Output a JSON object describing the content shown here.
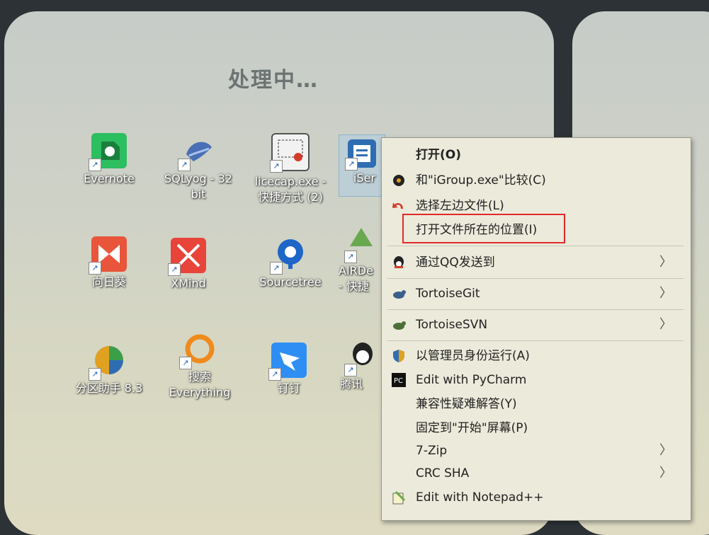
{
  "desktop": {
    "processing_text": "处理中…",
    "icons": [
      {
        "label": "Evernote",
        "icon": "evernote-icon",
        "color": "#2dbe60"
      },
      {
        "label": "SQLyog - 32\nbit",
        "icon": "sqlyog-icon",
        "color": "#4a6fb5"
      },
      {
        "label": "licecap.exe -\n快捷方式 (2)",
        "icon": "licecap-icon",
        "color": "#d23a2a"
      },
      {
        "label": "iSer",
        "icon": "iserver-icon",
        "color": "#2f6db3"
      },
      {
        "label": "向日葵",
        "icon": "sunflower-icon",
        "color": "#e8553a"
      },
      {
        "label": "XMind",
        "icon": "xmind-icon",
        "color": "#e8443a"
      },
      {
        "label": "Sourcetree",
        "icon": "sourcetree-icon",
        "color": "#1e66c7"
      },
      {
        "label": "AIRDe\n- 快捷",
        "icon": "airdesk-icon",
        "color": "#6aa84f"
      },
      {
        "label": "分区助手 8.3",
        "icon": "partition-icon",
        "color": "#e0a020"
      },
      {
        "label": "搜索\nEverything",
        "icon": "everything-icon",
        "color": "#f08a1c"
      },
      {
        "label": "钉钉",
        "icon": "dingtalk-icon",
        "color": "#2f8ef4"
      },
      {
        "label": "腾讯",
        "icon": "tencent-icon",
        "color": "#222222"
      }
    ]
  },
  "context_menu": {
    "items": [
      {
        "label": "打开(O)",
        "icon": "",
        "bold": true
      },
      {
        "label": "和\"iGroup.exe\"比较(C)",
        "icon": "compare-icon"
      },
      {
        "label": "选择左边文件(L)",
        "icon": "select-left-icon"
      },
      {
        "label": "打开文件所在的位置(I)",
        "icon": ""
      },
      {
        "label": "通过QQ发送到",
        "icon": "qq-icon",
        "submenu": true
      },
      {
        "label": "TortoiseGit",
        "icon": "tortoisegit-icon",
        "submenu": true
      },
      {
        "label": "TortoiseSVN",
        "icon": "tortoisesvn-icon",
        "submenu": true
      },
      {
        "label": "以管理员身份运行(A)",
        "icon": "shield-icon"
      },
      {
        "label": "Edit with PyCharm",
        "icon": "pycharm-icon"
      },
      {
        "label": "兼容性疑难解答(Y)",
        "icon": ""
      },
      {
        "label": "固定到\"开始\"屏幕(P)",
        "icon": ""
      },
      {
        "label": "7-Zip",
        "icon": "",
        "submenu": true
      },
      {
        "label": "CRC SHA",
        "icon": "",
        "submenu": true
      },
      {
        "label": "Edit with Notepad++",
        "icon": "notepadpp-icon"
      }
    ],
    "submenu_glyph": "〉",
    "highlight_color": "#e12a2a"
  }
}
